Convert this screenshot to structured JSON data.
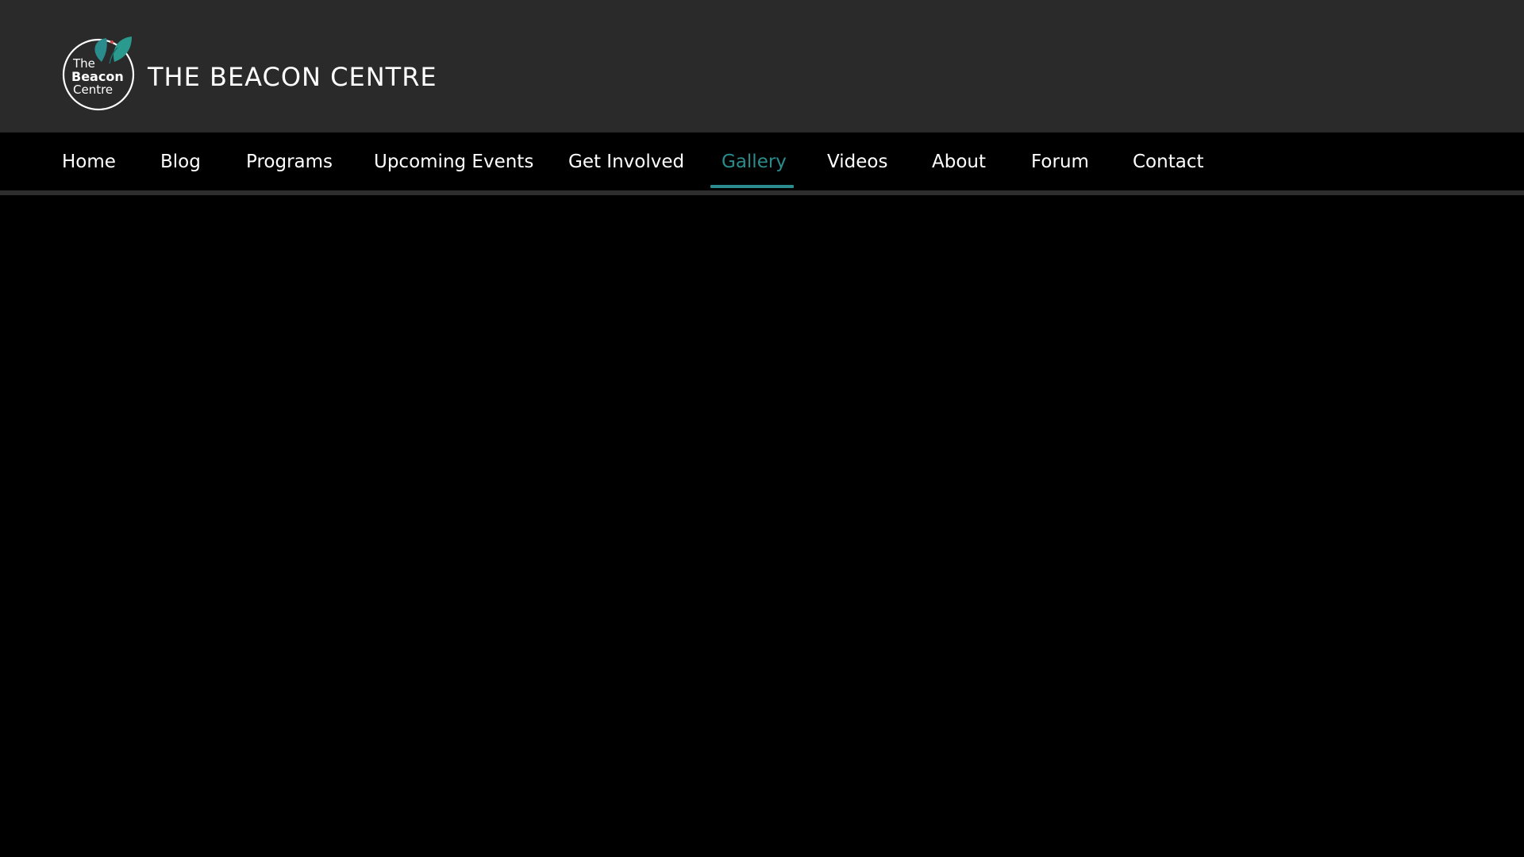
{
  "site": {
    "title": "THE BEACON CENTRE",
    "logo_text": {
      "line1": "The",
      "line2": "Beacon",
      "line3": "Centre"
    }
  },
  "nav": {
    "items": [
      {
        "label": "Home"
      },
      {
        "label": "Blog"
      },
      {
        "label": "Programs"
      },
      {
        "label": "Upcoming Events"
      },
      {
        "label": "Get Involved"
      },
      {
        "label": "Gallery",
        "active": true
      },
      {
        "label": "Videos"
      },
      {
        "label": "About"
      },
      {
        "label": "Forum"
      },
      {
        "label": "Contact"
      }
    ]
  },
  "colors": {
    "header_bg": "#2a2a2a",
    "page_bg": "#000000",
    "accent": "#2a8c8c"
  }
}
